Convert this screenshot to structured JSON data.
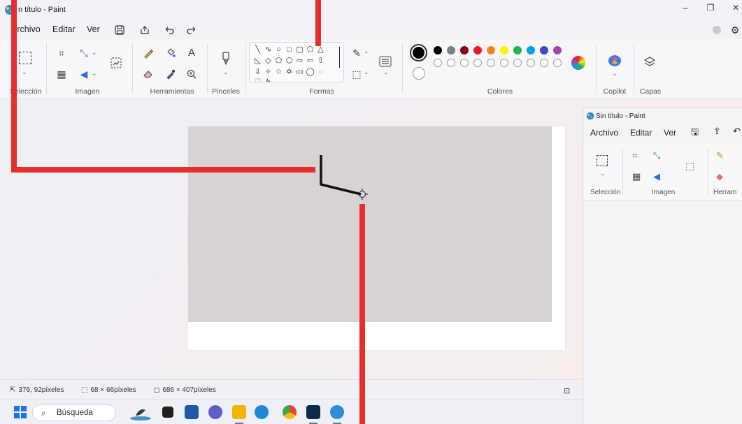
{
  "window": {
    "title": "Sin título - Paint",
    "title_visible": "n título - Paint",
    "controls": {
      "minimize": "–",
      "maximize": "❐",
      "close": "✕"
    }
  },
  "menu": {
    "items": [
      "Archivo",
      "Editar",
      "Ver"
    ],
    "quick_actions": [
      "save-icon",
      "share-icon",
      "undo-icon",
      "redo-icon"
    ],
    "right_icons": [
      "account-icon",
      "settings-icon"
    ]
  },
  "ribbon": {
    "groups": {
      "seleccion": "Selección",
      "imagen": "Imagen",
      "herramientas": "Herramientas",
      "pinceles": "Pinceles",
      "formas": "Formas",
      "colores": "Colores",
      "copilot": "Copilot",
      "capas": "Capas"
    },
    "text_tool_glyph": "A",
    "colors": {
      "primary": "#000000",
      "secondary": "#ffffff",
      "row1": [
        "#000000",
        "#7f7f7f",
        "#880015",
        "#ed1c24",
        "#ff7f27",
        "#fff200",
        "#22b14c",
        "#00a2e8",
        "#3f48cc",
        "#a349a4"
      ],
      "row2": [
        "#ffffff",
        "#c3c3c3",
        "#b97a57",
        "#ffaec9",
        "#ffc90e",
        "#efe4b0",
        "#b5e61d",
        "#99d9ea",
        "#7092be",
        "#c8bfe7"
      ]
    }
  },
  "status": {
    "cursor_position": "376, 92píxeles",
    "selection_size": "68 × 66píxeles",
    "canvas_size": "686 × 407píxeles"
  },
  "taskbar": {
    "search_placeholder": "Búsqueda"
  },
  "second_window": {
    "title": "Sin título - Paint",
    "menu": [
      "Archivo",
      "Editar",
      "Ver"
    ],
    "groups": {
      "seleccion": "Selección",
      "imagen": "Imagen",
      "herramientas": "Herram"
    }
  }
}
